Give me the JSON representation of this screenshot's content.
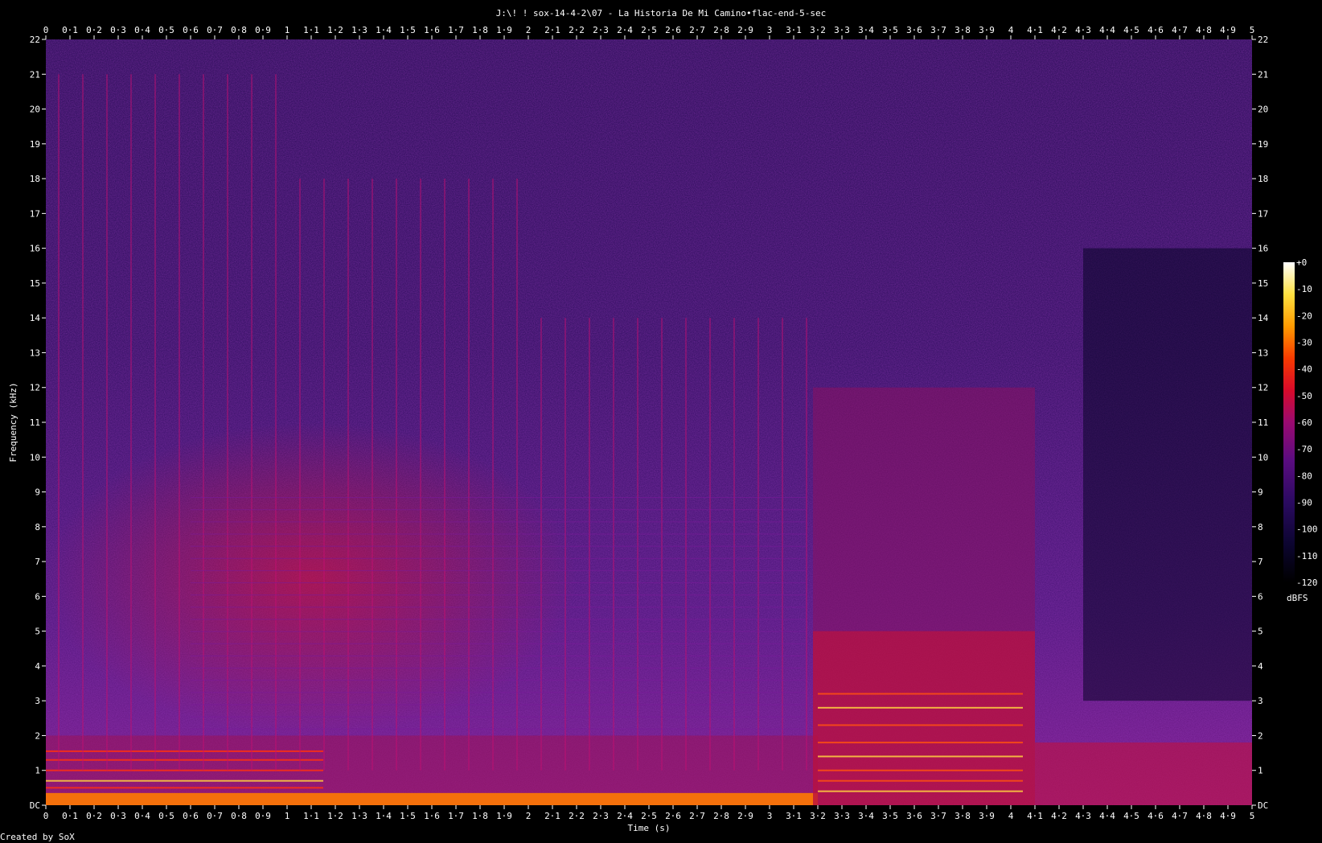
{
  "chart_data": {
    "type": "heatmap",
    "title": "J:\\! ! sox-14-4-2\\07 - La Historia De Mi Camino•flac-end-5-sec",
    "xlabel": "Time (s)",
    "ylabel": "Frequency (kHz)",
    "xlim": [
      0,
      5
    ],
    "ylim": [
      0,
      22
    ],
    "x_ticks": [
      "0",
      "0·1",
      "0·2",
      "0·3",
      "0·4",
      "0·5",
      "0·6",
      "0·7",
      "0·8",
      "0·9",
      "1",
      "1·1",
      "1·2",
      "1·3",
      "1·4",
      "1·5",
      "1·6",
      "1·7",
      "1·8",
      "1·9",
      "2",
      "2·1",
      "2·2",
      "2·3",
      "2·4",
      "2·5",
      "2·6",
      "2·7",
      "2·8",
      "2·9",
      "3",
      "3·1",
      "3·2",
      "3·3",
      "3·4",
      "3·5",
      "3·6",
      "3·7",
      "3·8",
      "3·9",
      "4",
      "4·1",
      "4·2",
      "4·3",
      "4·4",
      "4·5",
      "4·6",
      "4·7",
      "4·8",
      "4·9",
      "5"
    ],
    "y_ticks": [
      "DC",
      "1",
      "2",
      "3",
      "4",
      "5",
      "6",
      "7",
      "8",
      "9",
      "10",
      "11",
      "12",
      "13",
      "14",
      "15",
      "16",
      "17",
      "18",
      "19",
      "20",
      "21",
      "22"
    ],
    "colorbar": {
      "unit": "dBFS",
      "ticks": [
        "+0",
        "-10",
        "-20",
        "-30",
        "-40",
        "-50",
        "-60",
        "-70",
        "-80",
        "-90",
        "-100",
        "-110",
        "-120"
      ],
      "range": [
        -120,
        0
      ]
    },
    "footer": "Created by SoX"
  }
}
